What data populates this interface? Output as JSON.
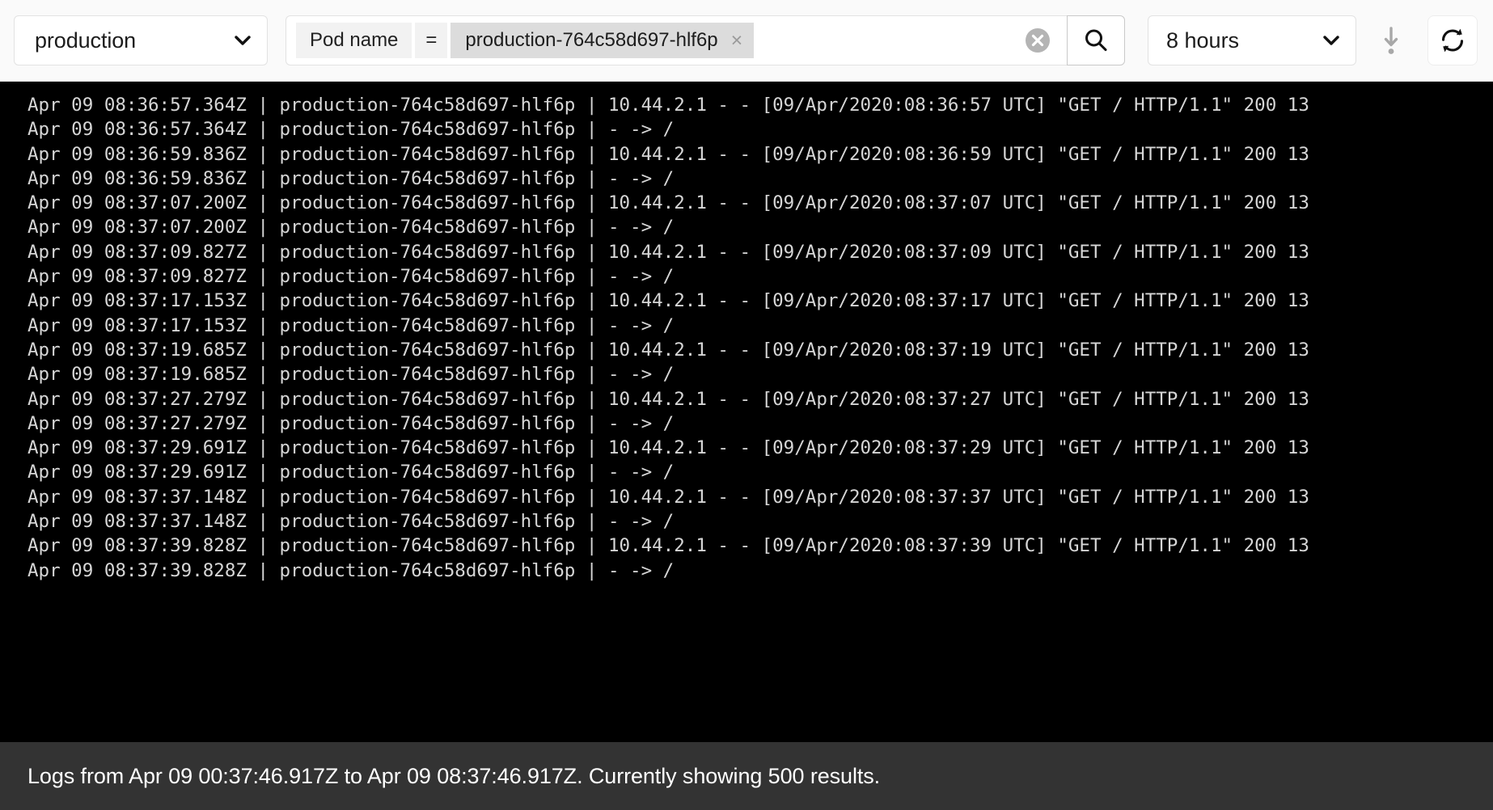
{
  "toolbar": {
    "namespace": {
      "value": "production",
      "icon": "chevron-down-icon"
    },
    "filter": {
      "chip_key": "Pod name",
      "chip_operator": "=",
      "chip_value": "production-764c58d697-hlf6p",
      "chip_remove_label": "×",
      "clear_icon": "clear-circle-icon",
      "search_icon": "search-icon"
    },
    "time_range": {
      "value": "8 hours",
      "icon": "chevron-down-icon"
    },
    "download_icon": "download-icon",
    "refresh_icon": "refresh-icon"
  },
  "console": {
    "lines": [
      "Apr 09 08:36:57.364Z | production-764c58d697-hlf6p | 10.44.2.1 - - [09/Apr/2020:08:36:57 UTC] \"GET / HTTP/1.1\" 200 13",
      "Apr 09 08:36:57.364Z | production-764c58d697-hlf6p | - -> /",
      "Apr 09 08:36:59.836Z | production-764c58d697-hlf6p | 10.44.2.1 - - [09/Apr/2020:08:36:59 UTC] \"GET / HTTP/1.1\" 200 13",
      "Apr 09 08:36:59.836Z | production-764c58d697-hlf6p | - -> /",
      "Apr 09 08:37:07.200Z | production-764c58d697-hlf6p | 10.44.2.1 - - [09/Apr/2020:08:37:07 UTC] \"GET / HTTP/1.1\" 200 13",
      "Apr 09 08:37:07.200Z | production-764c58d697-hlf6p | - -> /",
      "Apr 09 08:37:09.827Z | production-764c58d697-hlf6p | 10.44.2.1 - - [09/Apr/2020:08:37:09 UTC] \"GET / HTTP/1.1\" 200 13",
      "Apr 09 08:37:09.827Z | production-764c58d697-hlf6p | - -> /",
      "Apr 09 08:37:17.153Z | production-764c58d697-hlf6p | 10.44.2.1 - - [09/Apr/2020:08:37:17 UTC] \"GET / HTTP/1.1\" 200 13",
      "Apr 09 08:37:17.153Z | production-764c58d697-hlf6p | - -> /",
      "Apr 09 08:37:19.685Z | production-764c58d697-hlf6p | 10.44.2.1 - - [09/Apr/2020:08:37:19 UTC] \"GET / HTTP/1.1\" 200 13",
      "Apr 09 08:37:19.685Z | production-764c58d697-hlf6p | - -> /",
      "Apr 09 08:37:27.279Z | production-764c58d697-hlf6p | 10.44.2.1 - - [09/Apr/2020:08:37:27 UTC] \"GET / HTTP/1.1\" 200 13",
      "Apr 09 08:37:27.279Z | production-764c58d697-hlf6p | - -> /",
      "Apr 09 08:37:29.691Z | production-764c58d697-hlf6p | 10.44.2.1 - - [09/Apr/2020:08:37:29 UTC] \"GET / HTTP/1.1\" 200 13",
      "Apr 09 08:37:29.691Z | production-764c58d697-hlf6p | - -> /",
      "Apr 09 08:37:37.148Z | production-764c58d697-hlf6p | 10.44.2.1 - - [09/Apr/2020:08:37:37 UTC] \"GET / HTTP/1.1\" 200 13",
      "Apr 09 08:37:37.148Z | production-764c58d697-hlf6p | - -> /",
      "Apr 09 08:37:39.828Z | production-764c58d697-hlf6p | 10.44.2.1 - - [09/Apr/2020:08:37:39 UTC] \"GET / HTTP/1.1\" 200 13",
      "Apr 09 08:37:39.828Z | production-764c58d697-hlf6p | - -> /"
    ]
  },
  "footer": {
    "status": "Logs from Apr 09 00:37:46.917Z to Apr 09 08:37:46.917Z. Currently showing 500 results."
  },
  "colors": {
    "console_bg": "#000000",
    "console_text": "#d6d6d6",
    "footer_bg": "#333333",
    "footer_text": "#ffffff",
    "toolbar_bg": "#fafafa",
    "chip_key_bg": "#f2f2f2",
    "chip_value_bg": "#dcdcdc"
  }
}
